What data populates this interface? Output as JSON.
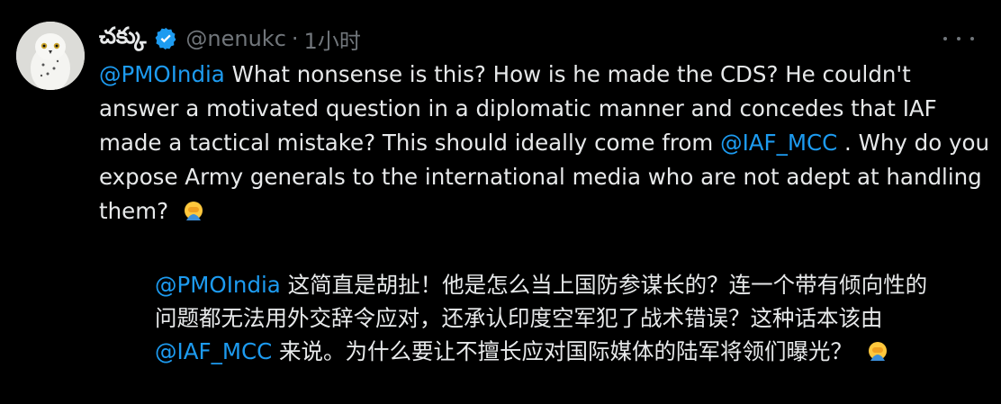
{
  "author": {
    "display_name": "చక్కు",
    "handle": "@nenukc",
    "separator": "·",
    "time": "1小时"
  },
  "tweet": {
    "mention1": "@PMOIndia",
    "text1": " What nonsense is this? How is he made the CDS? He couldn't answer a motivated question in a diplomatic manner and concedes that IAF made a tactical mistake? This should ideally come from ",
    "mention2": "@IAF_MCC",
    "text2": " . Why do you expose Army generals to the international media who are not adept at handling them? "
  },
  "translation": {
    "mention1": "@PMOIndia",
    "text1": " 这简直是胡扯！他是怎么当上国防参谋长的？连一个带有倾向性的问题都无法用外交辞令应对，还承认印度空军犯了战术错误？这种话本该由 ",
    "mention2": "@IAF_MCC",
    "text2": " 来说。为什么要让不擅长应对国际媒体的陆军将领们曝光？ "
  },
  "icons": {
    "avatar": "snowy-owl-avatar",
    "verified": "verified-badge-icon",
    "more": "more-options-icon",
    "emoji": "facepalm-emoji-icon"
  },
  "colors": {
    "background": "#000000",
    "text": "#e7e9ea",
    "muted": "#71767b",
    "link": "#1d9bf0"
  }
}
